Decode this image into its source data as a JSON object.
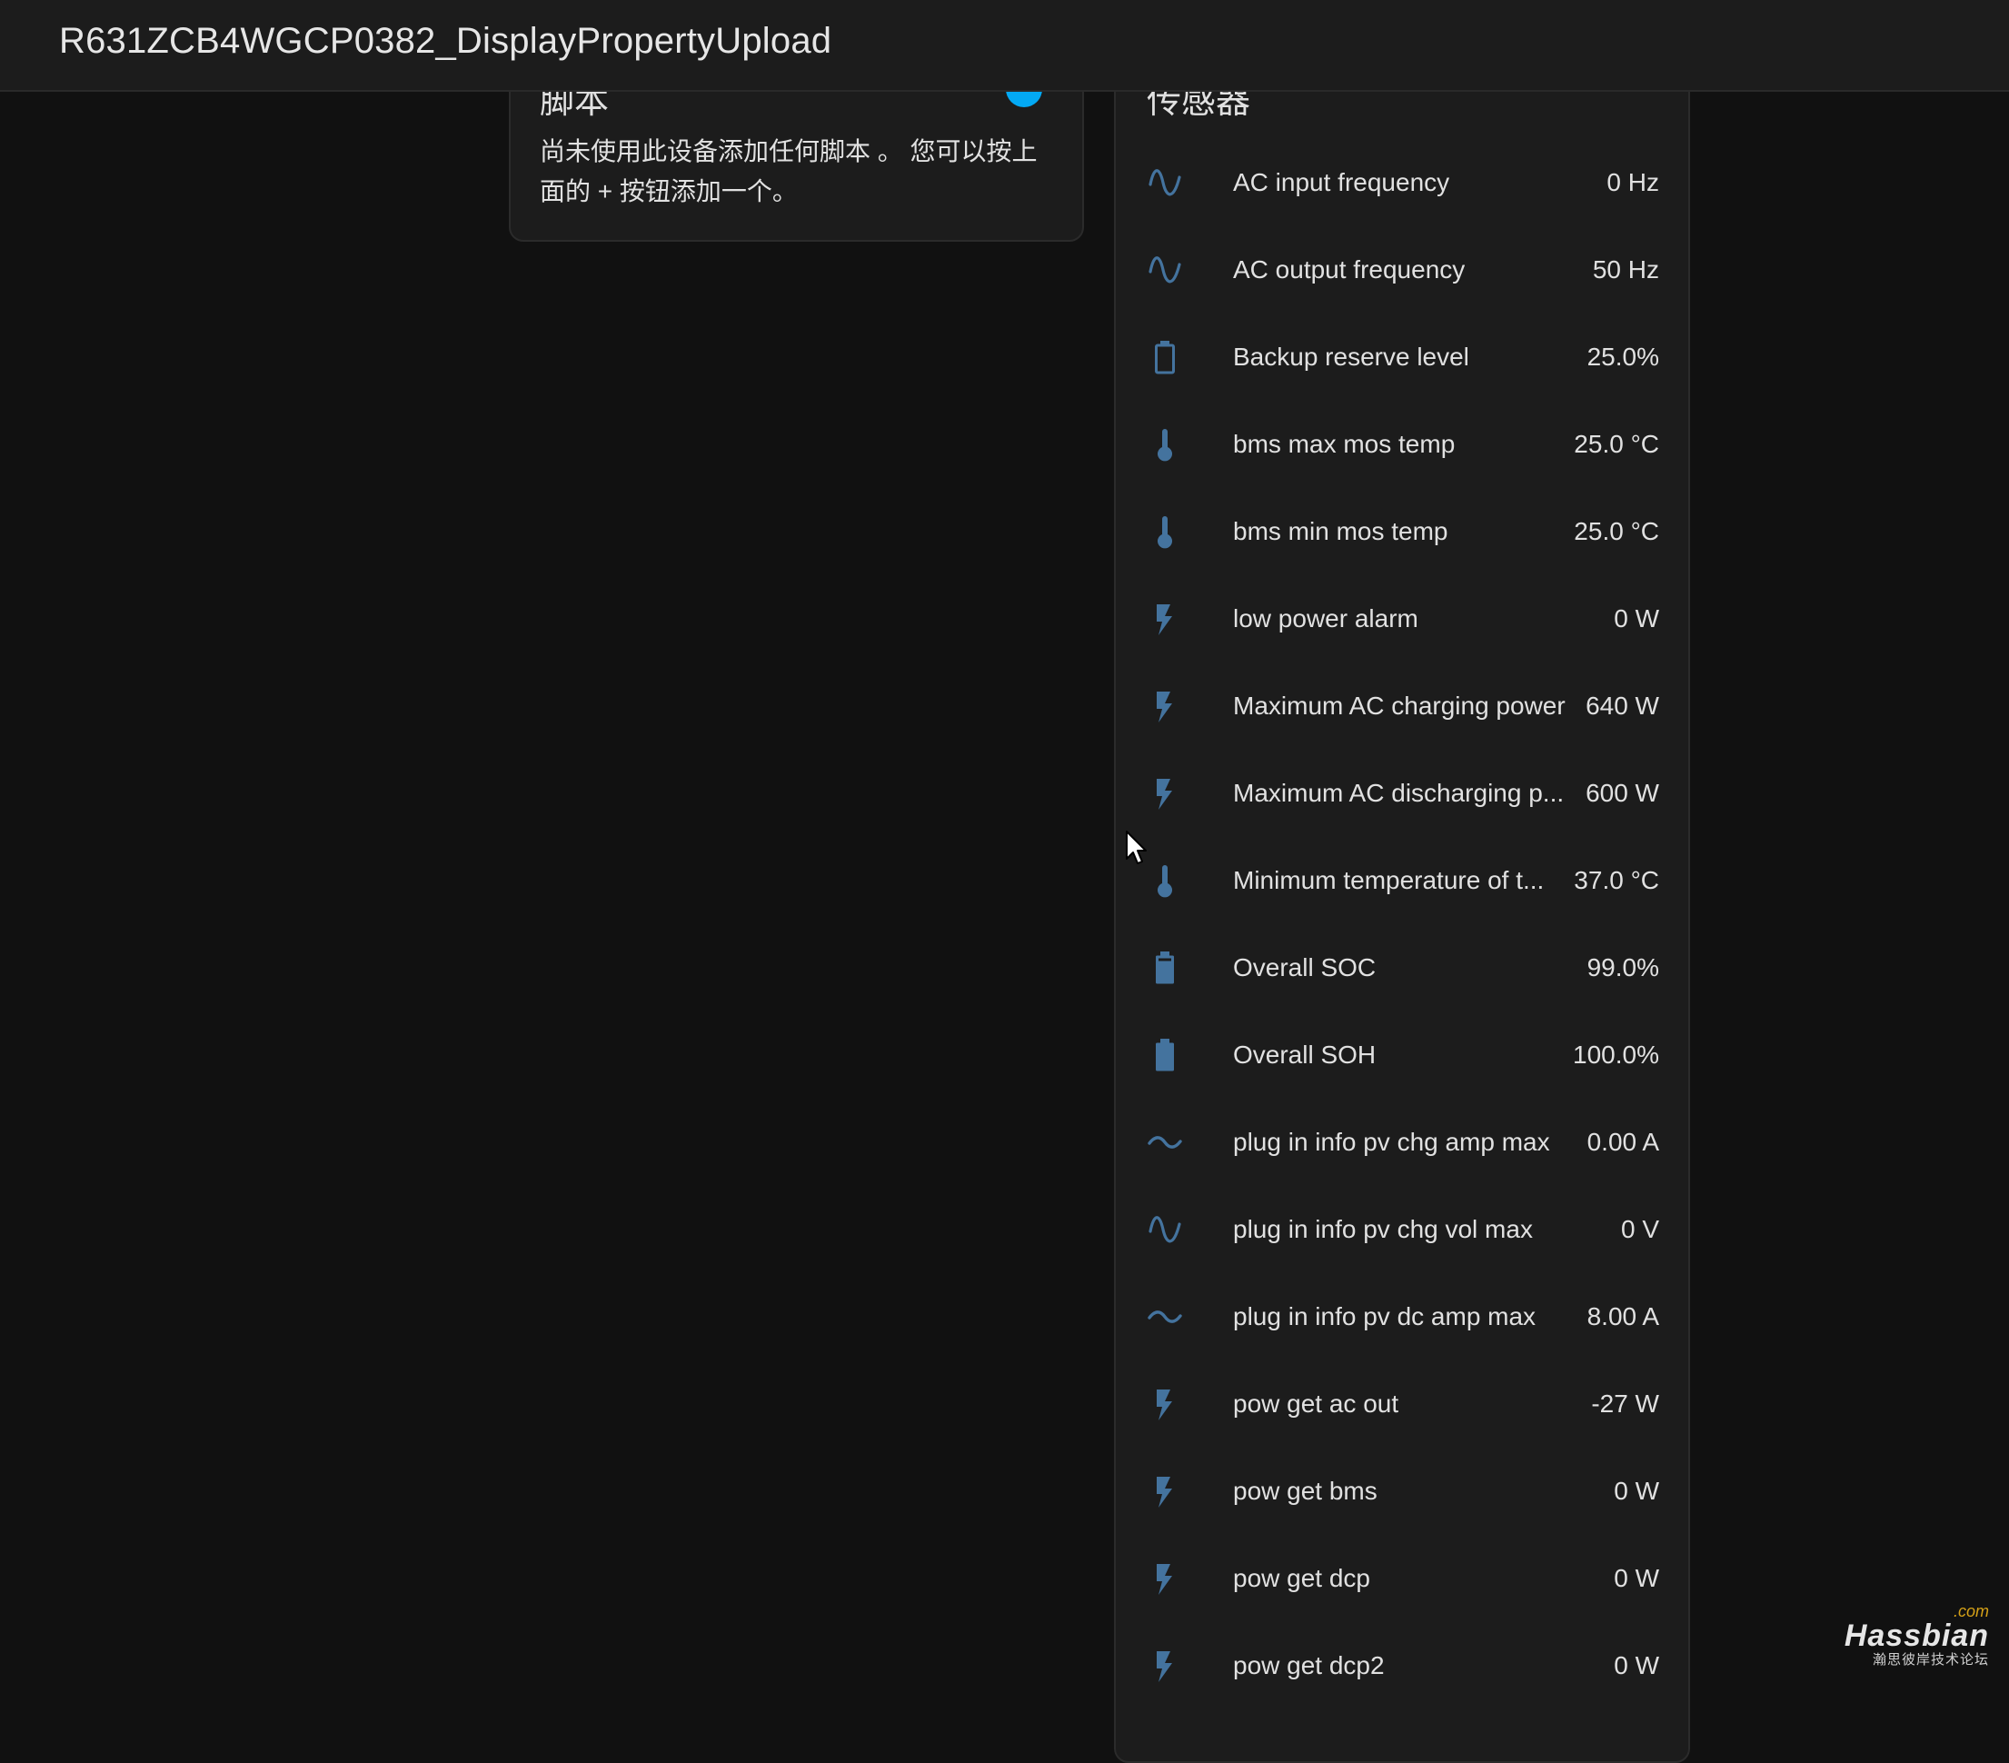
{
  "topbar": {
    "title": "R631ZCB4WGCP0382_DisplayPropertyUpload"
  },
  "scripts_card": {
    "title": "脚本",
    "message": "尚未使用此设备添加任何脚本 。 您可以按上面的 + 按钮添加一个。"
  },
  "sensors_card": {
    "title": "传感器",
    "items": [
      {
        "icon": "sine-wave-icon",
        "name": "AC input frequency",
        "value": "0 Hz"
      },
      {
        "icon": "sine-wave-icon",
        "name": "AC output frequency",
        "value": "50 Hz"
      },
      {
        "icon": "battery-outline-icon",
        "name": "Backup reserve level",
        "value": "25.0%"
      },
      {
        "icon": "thermometer-icon",
        "name": "bms max mos temp",
        "value": "25.0 °C"
      },
      {
        "icon": "thermometer-icon",
        "name": "bms min mos temp",
        "value": "25.0 °C"
      },
      {
        "icon": "flash-icon",
        "name": "low power alarm",
        "value": "0 W"
      },
      {
        "icon": "flash-icon",
        "name": "Maximum AC charging power",
        "value": "640 W"
      },
      {
        "icon": "flash-icon",
        "name": "Maximum AC discharging p...",
        "value": "600 W"
      },
      {
        "icon": "thermometer-icon",
        "name": "Minimum temperature of t...",
        "value": "37.0 °C"
      },
      {
        "icon": "battery-high-icon",
        "name": "Overall SOC",
        "value": "99.0%"
      },
      {
        "icon": "battery-full-icon",
        "name": "Overall SOH",
        "value": "100.0%"
      },
      {
        "icon": "current-ac-icon",
        "name": "plug in info pv chg amp max",
        "value": "0.00 A"
      },
      {
        "icon": "sine-wave-icon",
        "name": "plug in info pv chg vol max",
        "value": "0 V"
      },
      {
        "icon": "current-ac-icon",
        "name": "plug in info pv dc amp max",
        "value": "8.00 A"
      },
      {
        "icon": "flash-icon",
        "name": "pow get ac out",
        "value": "-27 W"
      },
      {
        "icon": "flash-icon",
        "name": "pow get bms",
        "value": "0 W"
      },
      {
        "icon": "flash-icon",
        "name": "pow get dcp",
        "value": "0 W"
      },
      {
        "icon": "flash-icon",
        "name": "pow get dcp2",
        "value": "0 W"
      }
    ]
  },
  "watermark": {
    "com": ".com",
    "brand": "Hassbian",
    "sub": "瀚思彼岸技术论坛"
  },
  "colors": {
    "background": "#111111",
    "card": "#1c1c1c",
    "icon": "#44739e",
    "accent": "#03a9f4",
    "text": "#e1e1e1"
  }
}
